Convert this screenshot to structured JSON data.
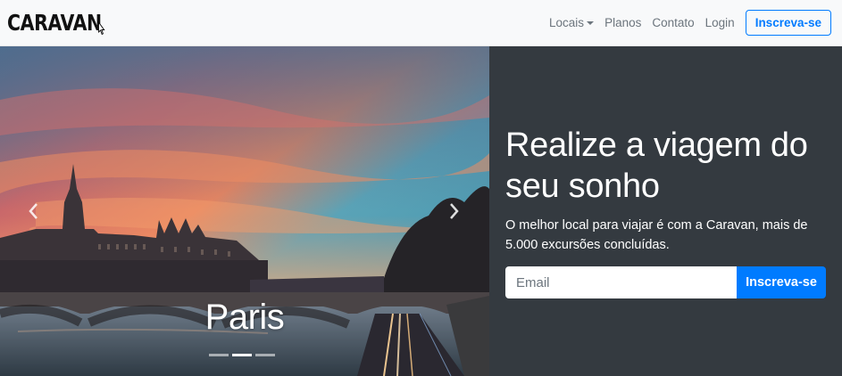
{
  "navbar": {
    "brand": "CARAVAN",
    "links": {
      "locais": "Locais",
      "planos": "Planos",
      "contato": "Contato",
      "login": "Login"
    },
    "cta_label": "Inscreva-se"
  },
  "carousel": {
    "caption": "Paris",
    "slide_count": 3,
    "active_slide": 2
  },
  "hero": {
    "title": "Realize a viagem do seu sonho",
    "text": "O melhor local para viajar é com a Caravan, mais de 5.000 excursões concluídas.",
    "email_placeholder": "Email",
    "button_label": "Inscreva-se"
  },
  "colors": {
    "primary": "#007bff",
    "dark_panel": "#343a40",
    "navbar_bg": "#f8f9fa"
  }
}
